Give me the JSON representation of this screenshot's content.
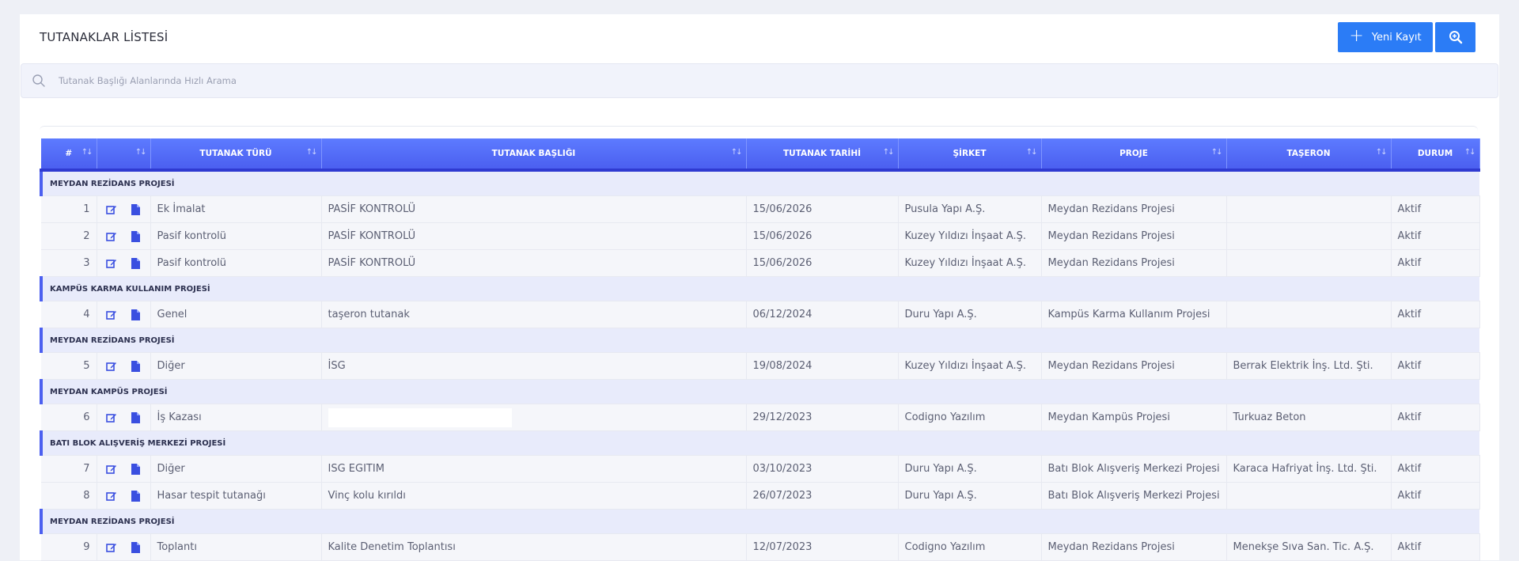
{
  "page": {
    "title": "TUTANAKLAR LİSTESİ"
  },
  "toolbar": {
    "new_label": "Yeni Kayıt",
    "new_icon": "plus-icon",
    "zoom_icon": "zoom-in-icon"
  },
  "search": {
    "placeholder": "Tutanak Başlığı Alanlarında Hızlı Arama",
    "value": ""
  },
  "colors": {
    "accent": "#2b7cf6",
    "header": "#4b5ff0",
    "group_bg": "#e8ebfb"
  },
  "table": {
    "columns": [
      "#",
      "",
      "TUTANAK TÜRÜ",
      "TUTANAK BAŞLIĞI",
      "TUTANAK TARİHİ",
      "ŞİRKET",
      "PROJE",
      "TAŞERON",
      "DURUM"
    ],
    "groups": [
      {
        "label": "MEYDAN REZİDANS PROJESİ",
        "rows": [
          {
            "no": "1",
            "type": "Ek İmalat",
            "title": "PASİF KONTROLÜ",
            "date": "15/06/2026",
            "company": "Pusula Yapı A.Ş.",
            "project": "Meydan Rezidans Projesi",
            "subcontractor": "",
            "status": "Aktif"
          },
          {
            "no": "2",
            "type": "Pasif kontrolü",
            "title": "PASİF KONTROLÜ",
            "date": "15/06/2026",
            "company": "Kuzey Yıldızı İnşaat A.Ş.",
            "project": "Meydan Rezidans Projesi",
            "subcontractor": "",
            "status": "Aktif"
          },
          {
            "no": "3",
            "type": "Pasif kontrolü",
            "title": "PASİF KONTROLÜ",
            "date": "15/06/2026",
            "company": "Kuzey Yıldızı İnşaat A.Ş.",
            "project": "Meydan Rezidans Projesi",
            "subcontractor": "",
            "status": "Aktif"
          }
        ]
      },
      {
        "label": "KAMPÜS KARMA KULLANIM PROJESİ",
        "rows": [
          {
            "no": "4",
            "type": "Genel",
            "title": "taşeron tutanak",
            "date": "06/12/2024",
            "company": "Duru Yapı A.Ş.",
            "project": "Kampüs Karma Kullanım Projesi",
            "subcontractor": "",
            "status": "Aktif"
          }
        ]
      },
      {
        "label": "MEYDAN REZİDANS PROJESİ",
        "rows": [
          {
            "no": "5",
            "type": "Diğer",
            "title": "İSG",
            "date": "19/08/2024",
            "company": "Kuzey Yıldızı İnşaat A.Ş.",
            "project": "Meydan Rezidans Projesi",
            "subcontractor": "Berrak Elektrik İnş. Ltd. Şti.",
            "status": "Aktif"
          }
        ]
      },
      {
        "label": "MEYDAN KAMPÜS PROJESİ",
        "rows": [
          {
            "no": "6",
            "type": "İş Kazası",
            "title": "",
            "date": "29/12/2023",
            "company": "Codigno Yazılım",
            "project": "Meydan Kampüs Projesi",
            "subcontractor": "Turkuaz Beton",
            "status": "Aktif"
          }
        ]
      },
      {
        "label": "BATI BLOK ALIŞVERİŞ MERKEZİ PROJESİ",
        "rows": [
          {
            "no": "7",
            "type": "Diğer",
            "title": "ISG EGITIM",
            "date": "03/10/2023",
            "company": "Duru Yapı A.Ş.",
            "project": "Batı Blok Alışveriş Merkezi Projesi",
            "subcontractor": "Karaca Hafriyat İnş. Ltd. Şti.",
            "status": "Aktif"
          },
          {
            "no": "8",
            "type": "Hasar tespit tutanağı",
            "title": "Vinç kolu kırıldı",
            "date": "26/07/2023",
            "company": "Duru Yapı A.Ş.",
            "project": "Batı Blok Alışveriş Merkezi Projesi",
            "subcontractor": "",
            "status": "Aktif"
          }
        ]
      },
      {
        "label": "MEYDAN REZİDANS PROJESİ",
        "rows": [
          {
            "no": "9",
            "type": "Toplantı",
            "title": "Kalite Denetim Toplantısı",
            "date": "12/07/2023",
            "company": "Codigno Yazılım",
            "project": "Meydan Rezidans Projesi",
            "subcontractor": "Menekşe Sıva San. Tic. A.Ş.",
            "status": "Aktif"
          }
        ]
      }
    ]
  }
}
